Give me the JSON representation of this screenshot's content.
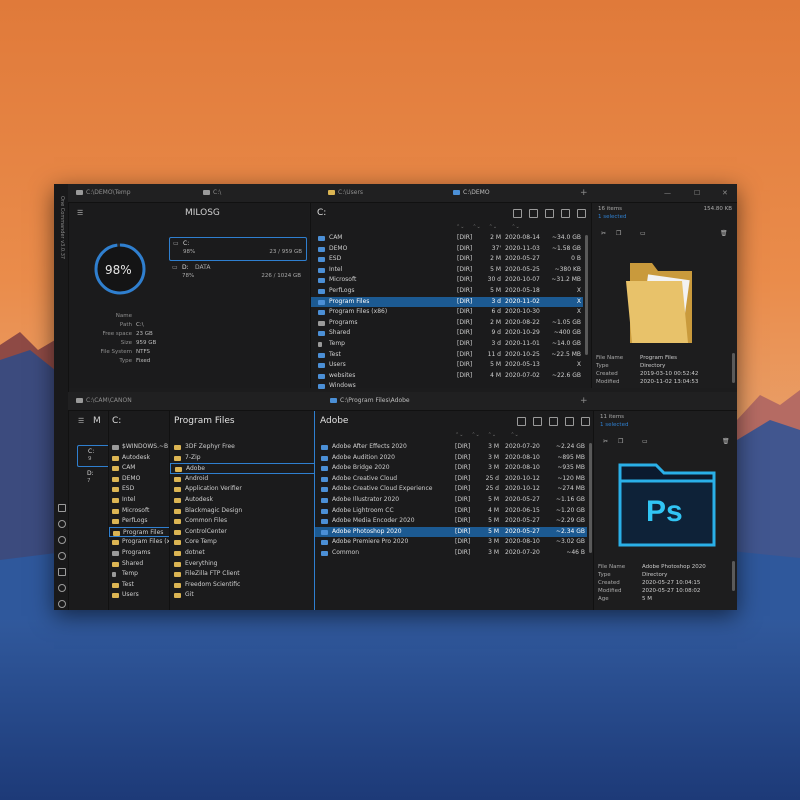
{
  "colors": {
    "accent": "#2f7fcf",
    "selection": "#1c5a92",
    "folder": "#dcb553",
    "window_bg": "#1c1c1d"
  },
  "app": {
    "title_vertical": "One Commander v3.0.37"
  },
  "top_tabs": [
    "C:\\DEMO\\Temp",
    "C:\\",
    "C:\\Users",
    "C:\\DEMO"
  ],
  "window_controls": {
    "minimize": "—",
    "maximize": "☐",
    "close": "✕",
    "add_tab": "+"
  },
  "drives_panel": {
    "header": "MILOSG",
    "gauge": "98%",
    "drive_c": {
      "name": "C:",
      "percent": "98%",
      "size": "23 / 959 GB"
    },
    "drive_d": {
      "name": "D:",
      "label": "DATA",
      "percent": "78%",
      "size": "226 / 1024 GB"
    },
    "details": [
      {
        "k": "Name",
        "v": ""
      },
      {
        "k": "Path",
        "v": "C:\\"
      },
      {
        "k": "Free space",
        "v": "23 GB"
      },
      {
        "k": "Size",
        "v": "959 GB"
      },
      {
        "k": "File System",
        "v": "NTFS"
      },
      {
        "k": "Type",
        "v": "Fixed"
      }
    ]
  },
  "c_list": {
    "header": "C:",
    "rows": [
      {
        "name": "CAM",
        "type": "[DIR]",
        "age": "2 M",
        "date": "2020-08-14",
        "size": "~34.0 GB"
      },
      {
        "name": "DEMO",
        "type": "[DIR]",
        "age": "37'",
        "date": "2020-11-03",
        "size": "~1.58 GB"
      },
      {
        "name": "ESD",
        "type": "[DIR]",
        "age": "2 M",
        "date": "2020-05-27",
        "size": "0 B"
      },
      {
        "name": "Intel",
        "type": "[DIR]",
        "age": "5 M",
        "date": "2020-05-25",
        "size": "~380 KB"
      },
      {
        "name": "Microsoft",
        "type": "[DIR]",
        "age": "30 d",
        "date": "2020-10-07",
        "size": "~31.2 MB"
      },
      {
        "name": "PerfLogs",
        "type": "[DIR]",
        "age": "5 M",
        "date": "2020-05-18",
        "size": "X"
      },
      {
        "name": "Program Files",
        "type": "[DIR]",
        "age": "3 d",
        "date": "2020-11-02",
        "size": "X",
        "selected": true
      },
      {
        "name": "Program Files (x86)",
        "type": "[DIR]",
        "age": "6 d",
        "date": "2020-10-30",
        "size": "X"
      },
      {
        "name": "Programs",
        "type": "[DIR]",
        "age": "2 M",
        "date": "2020-08-22",
        "size": "~1.05 GB"
      },
      {
        "name": "Shared",
        "type": "[DIR]",
        "age": "9 d",
        "date": "2020-10-29",
        "size": "~400 GB"
      },
      {
        "name": "Temp",
        "type": "[DIR]",
        "age": "3 d",
        "date": "2020-11-01",
        "size": "~14.0 GB"
      },
      {
        "name": "Test",
        "type": "[DIR]",
        "age": "11 d",
        "date": "2020-10-25",
        "size": "~22.5 MB"
      },
      {
        "name": "Users",
        "type": "[DIR]",
        "age": "5 M",
        "date": "2020-05-13",
        "size": "X"
      },
      {
        "name": "websites",
        "type": "[DIR]",
        "age": "4 M",
        "date": "2020-07-02",
        "size": "~22.6 GB"
      },
      {
        "name": "Windows",
        "type": "[DIR]",
        "age": "",
        "date": "",
        "size": ""
      }
    ]
  },
  "right_top": {
    "items": "16 items",
    "selected": "1 selected",
    "size": "154.80 KB",
    "props": [
      {
        "k": "File Name",
        "v": "Program Files"
      },
      {
        "k": "Type",
        "v": "Directory"
      },
      {
        "k": "Created",
        "v": "2019-03-10 00:52:42"
      },
      {
        "k": "Modified",
        "v": "2020-11-02 13:04:53"
      }
    ]
  },
  "bottom_tabs": [
    "C:\\CAM\\CANON",
    "C:\\Program Files\\Adobe"
  ],
  "bottom": {
    "mini_header": "M",
    "mini_drive_c": {
      "name": "C:",
      "percent": "9"
    },
    "mini_drive_d": {
      "name": "D:",
      "percent": "7"
    },
    "c_header": "C:",
    "c_rows": [
      "$WINDOWS.~B",
      "Autodesk",
      "CAM",
      "DEMO",
      "ESD",
      "Intel",
      "Microsoft",
      "PerfLogs",
      "Program Files",
      "Program Files (x86)",
      "Programs",
      "Shared",
      "Temp",
      "Test",
      "Users"
    ],
    "pf_header": "Program Files",
    "pf_rows": [
      "3DF Zephyr Free",
      "7-Zip",
      "Adobe",
      "Android",
      "Application Verifier",
      "Autodesk",
      "Blackmagic Design",
      "Common Files",
      "ControlCenter",
      "Core Temp",
      "dotnet",
      "Everything",
      "FileZilla FTP Client",
      "Freedom Scientific",
      "Git"
    ],
    "adobe_path": "C:\\Program Files\\Adobe",
    "adobe_header": "Adobe",
    "adobe_rows": [
      {
        "name": "Adobe After Effects 2020",
        "type": "[DIR]",
        "age": "3 M",
        "date": "2020-07-20",
        "size": "~2.24 GB"
      },
      {
        "name": "Adobe Audition 2020",
        "type": "[DIR]",
        "age": "3 M",
        "date": "2020-08-10",
        "size": "~895 MB"
      },
      {
        "name": "Adobe Bridge 2020",
        "type": "[DIR]",
        "age": "3 M",
        "date": "2020-08-10",
        "size": "~935 MB"
      },
      {
        "name": "Adobe Creative Cloud",
        "type": "[DIR]",
        "age": "25 d",
        "date": "2020-10-12",
        "size": "~120 MB"
      },
      {
        "name": "Adobe Creative Cloud Experience",
        "type": "[DIR]",
        "age": "25 d",
        "date": "2020-10-12",
        "size": "~274 MB"
      },
      {
        "name": "Adobe Illustrator 2020",
        "type": "[DIR]",
        "age": "5 M",
        "date": "2020-05-27",
        "size": "~1.16 GB"
      },
      {
        "name": "Adobe Lightroom CC",
        "type": "[DIR]",
        "age": "4 M",
        "date": "2020-06-15",
        "size": "~1.20 GB"
      },
      {
        "name": "Adobe Media Encoder 2020",
        "type": "[DIR]",
        "age": "5 M",
        "date": "2020-05-27",
        "size": "~2.29 GB"
      },
      {
        "name": "Adobe Photoshop 2020",
        "type": "[DIR]",
        "age": "5 M",
        "date": "2020-05-27",
        "size": "~2.34 GB",
        "selected": true
      },
      {
        "name": "Adobe Premiere Pro 2020",
        "type": "[DIR]",
        "age": "3 M",
        "date": "2020-08-10",
        "size": "~3.02 GB"
      },
      {
        "name": "Common",
        "type": "[DIR]",
        "age": "3 M",
        "date": "2020-07-20",
        "size": "~46 B"
      }
    ]
  },
  "right_bottom": {
    "items": "11 items",
    "selected": "1 selected",
    "ps_label": "Ps",
    "props": [
      {
        "k": "File Name",
        "v": "Adobe Photoshop 2020"
      },
      {
        "k": "Type",
        "v": "Directory"
      },
      {
        "k": "Created",
        "v": "2020-05-27 10:04:15"
      },
      {
        "k": "Modified",
        "v": "2020-05-27 10:08:02"
      },
      {
        "k": "Age",
        "v": "5 M"
      }
    ]
  }
}
